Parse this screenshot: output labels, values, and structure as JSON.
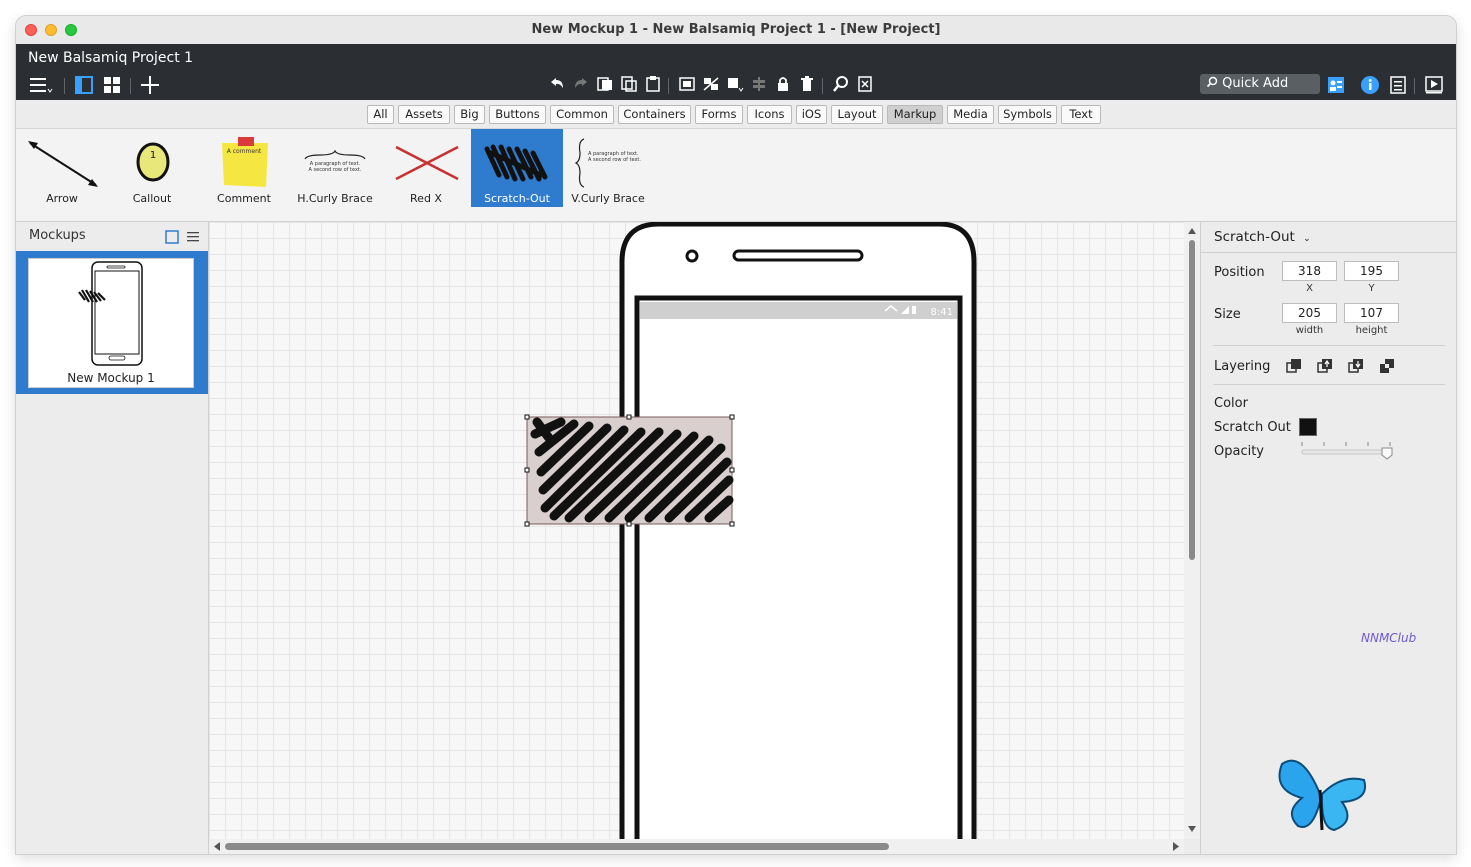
{
  "window": {
    "title": "New Mockup 1 - New Balsamiq Project 1 - [New Project]"
  },
  "project": {
    "title": "New Balsamiq Project 1"
  },
  "toolbar": {
    "quick_add": "Quick Add"
  },
  "library_tabs": [
    {
      "label": "All"
    },
    {
      "label": "Assets"
    },
    {
      "label": "Big"
    },
    {
      "label": "Buttons"
    },
    {
      "label": "Common"
    },
    {
      "label": "Containers"
    },
    {
      "label": "Forms"
    },
    {
      "label": "Icons"
    },
    {
      "label": "iOS"
    },
    {
      "label": "Layout"
    },
    {
      "label": "Markup",
      "active": true
    },
    {
      "label": "Media"
    },
    {
      "label": "Symbols"
    },
    {
      "label": "Text"
    }
  ],
  "palette": [
    {
      "label": "Arrow"
    },
    {
      "label": "Callout"
    },
    {
      "label": "Comment"
    },
    {
      "label": "H.Curly Brace"
    },
    {
      "label": "Red X"
    },
    {
      "label": "Scratch-Out",
      "active": true
    },
    {
      "label": "V.Curly Brace"
    }
  ],
  "palette_text": {
    "callout_number": "1",
    "comment_text": "A comment",
    "brace_line1": "A paragraph of text.",
    "brace_line2": "A second row of text."
  },
  "mockups_panel": {
    "title": "Mockups",
    "items": [
      {
        "label": "New Mockup 1",
        "selected": true
      }
    ]
  },
  "phone": {
    "status_time": "8:41"
  },
  "inspector": {
    "title": "Scratch-Out",
    "position_label": "Position",
    "x": "318",
    "x_label": "X",
    "y": "195",
    "y_label": "Y",
    "size_label": "Size",
    "width": "205",
    "width_label": "width",
    "height": "107",
    "height_label": "height",
    "layering_label": "Layering",
    "color_label": "Color",
    "scratch_out_label": "Scratch Out",
    "scratch_color": "#111111",
    "opacity_label": "Opacity",
    "opacity": 1.0
  },
  "watermark": "NNMClub",
  "colors": {
    "accent": "#2f7ccf",
    "appbar": "#2b2f33"
  }
}
